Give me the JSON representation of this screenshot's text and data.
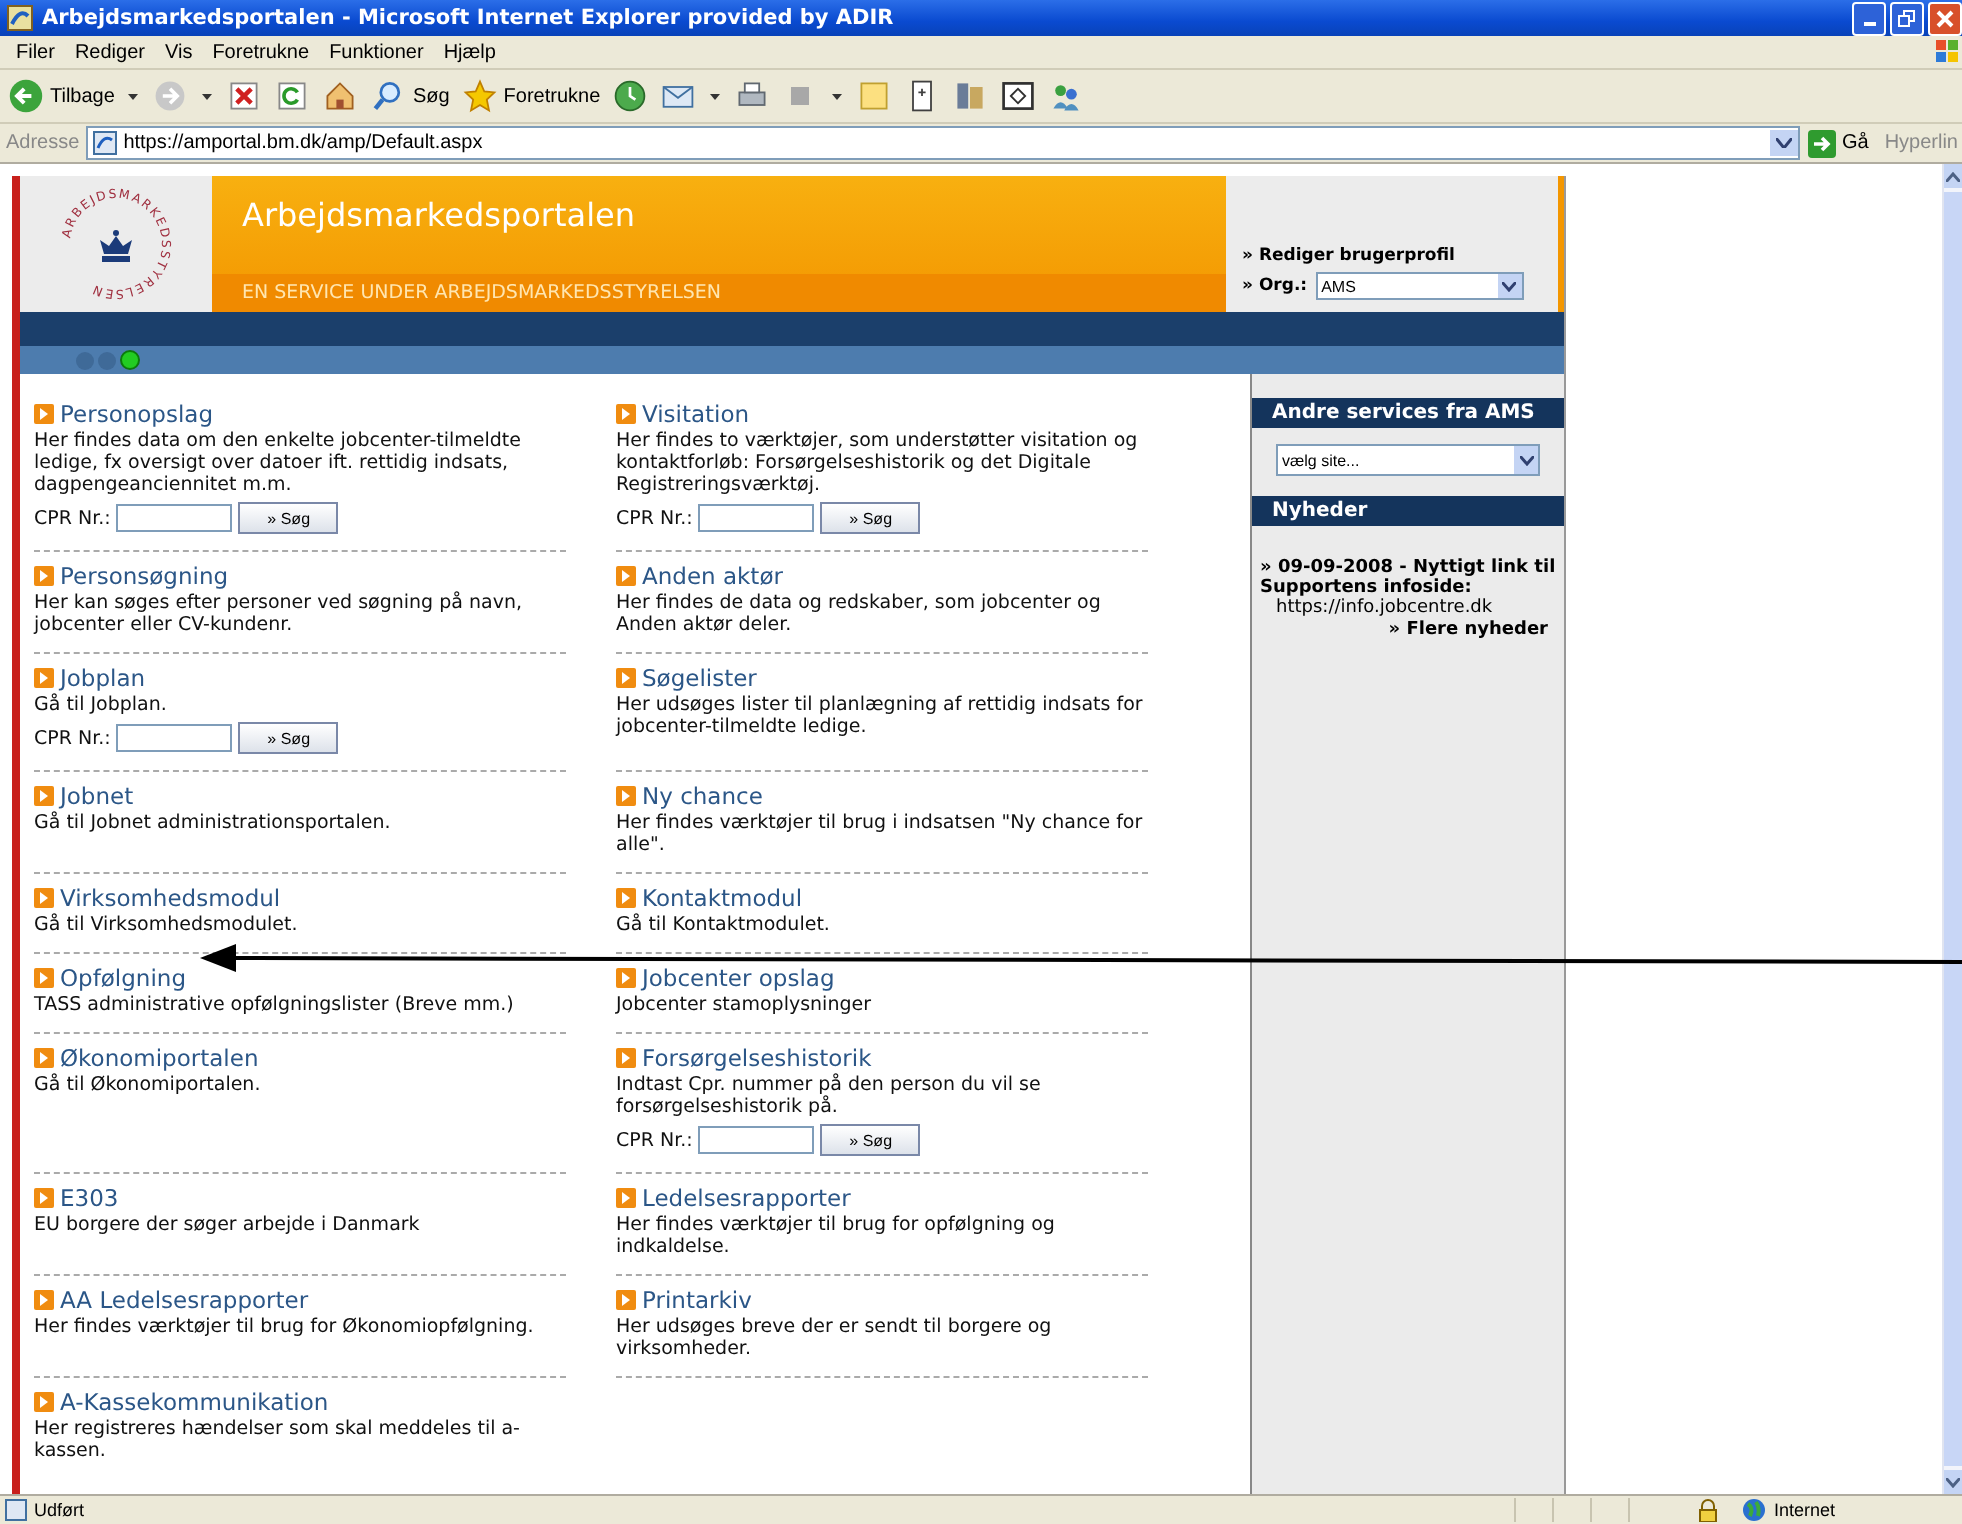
{
  "window": {
    "title": "Arbejdsmarkedsportalen - Microsoft Internet Explorer provided by ADIR"
  },
  "menu": [
    "Filer",
    "Rediger",
    "Vis",
    "Foretrukne",
    "Funktioner",
    "Hjælp"
  ],
  "toolbar": [
    {
      "kind": "back",
      "label": "Tilbage",
      "menu": true
    },
    {
      "kind": "forward",
      "menu": true
    },
    {
      "kind": "stop"
    },
    {
      "kind": "refresh"
    },
    {
      "kind": "home"
    },
    {
      "kind": "search",
      "label": "Søg"
    },
    {
      "kind": "favorites",
      "label": "Foretrukne"
    },
    {
      "kind": "history"
    },
    {
      "kind": "mail",
      "menu": true
    },
    {
      "kind": "print"
    },
    {
      "kind": "block",
      "menu": true
    },
    {
      "kind": "note"
    },
    {
      "kind": "page"
    },
    {
      "kind": "research"
    },
    {
      "kind": "window"
    },
    {
      "kind": "messenger"
    }
  ],
  "address": {
    "label": "Adresse",
    "url": "https://amportal.bm.dk/amp/Default.aspx",
    "go": "Gå",
    "links": "Hyperlin"
  },
  "portal": {
    "logo_text": "ARBEJDSMARKEDSSTYRELSEN",
    "title": "Arbejdsmarkedsportalen",
    "subtitle": "EN SERVICE UNDER ARBEJDSMARKEDSSTYRELSEN",
    "profile_link": "» Rediger brugerprofil",
    "org_label": "» Org.:",
    "org_value": "AMS",
    "lights": [
      {
        "on": false
      },
      {
        "on": false
      },
      {
        "on": true
      }
    ]
  },
  "rows": [
    {
      "left": {
        "title": "Personopslag",
        "text": "Her findes data om den enkelte jobcenter-tilmeldte ledige, fx oversigt over datoer ift. rettidig indsats, dagpengeanciennitet m.m.",
        "cpr": {
          "label": "CPR Nr.:",
          "button": "» Søg"
        }
      },
      "right": {
        "title": "Visitation",
        "text": "Her findes to værktøjer, som understøtter visitation og kontaktforløb: Forsørgelseshistorik og det Digitale Registreringsværktøj.",
        "cpr": {
          "label": "CPR Nr.:",
          "button": "» Søg"
        }
      }
    },
    {
      "left": {
        "title": "Personsøgning",
        "text": "Her kan søges efter personer ved søgning på navn, jobcenter eller CV-kundenr."
      },
      "right": {
        "title": "Anden aktør",
        "text": "Her findes de data og redskaber, som jobcenter og Anden aktør deler."
      }
    },
    {
      "left": {
        "title": "Jobplan",
        "text": "Gå til Jobplan.",
        "cpr": {
          "label": "CPR Nr.:",
          "button": "» Søg"
        }
      },
      "right": {
        "title": "Søgelister",
        "text": "Her udsøges lister til planlægning af rettidig indsats for jobcenter-tilmeldte ledige."
      }
    },
    {
      "left": {
        "title": "Jobnet",
        "text": "Gå til Jobnet administrationsportalen."
      },
      "right": {
        "title": "Ny chance",
        "text": "Her findes værktøjer til brug i indsatsen \"Ny chance for alle\"."
      }
    },
    {
      "left": {
        "title": "Virksomhedsmodul",
        "text": "Gå til Virksomhedsmodulet."
      },
      "right": {
        "title": "Kontaktmodul",
        "text": "Gå til Kontaktmodulet."
      }
    },
    {
      "left": {
        "title": "Opfølgning",
        "text": "TASS administrative opfølgningslister (Breve mm.)"
      },
      "right": {
        "title": "Jobcenter opslag",
        "text": "Jobcenter stamoplysninger"
      }
    },
    {
      "left": {
        "title": "Økonomiportalen",
        "text": "Gå til Økonomiportalen."
      },
      "right": {
        "title": "Forsørgelseshistorik",
        "text": "Indtast Cpr. nummer på den person du vil se forsørgelseshistorik på.",
        "cpr": {
          "label": "CPR Nr.:",
          "button": "» Søg"
        }
      }
    },
    {
      "left": {
        "title": "E303",
        "text": "EU borgere der søger arbejde i Danmark"
      },
      "right": {
        "title": "Ledelsesrapporter",
        "text": "Her findes værktøjer til brug for opfølgning og indkaldelse."
      }
    },
    {
      "left": {
        "title": "AA Ledelsesrapporter",
        "text": "Her findes værktøjer til brug for Økonomiopfølgning."
      },
      "right": {
        "title": "Printarkiv",
        "text": "Her udsøges breve der er sendt til borgere og virksomheder."
      }
    },
    {
      "left": {
        "title": "A-Kassekommunikation",
        "text": "Her registreres hændelser som skal meddeles til a-kassen."
      }
    }
  ],
  "sidebar": {
    "services_heading": "Andre services fra AMS",
    "services_select": "vælg site...",
    "news_heading": "Nyheder",
    "news": "» 09-09-2008 - Nyttigt link til Supportens infoside:",
    "news_link": "https://info.jobcentre.dk",
    "more_news": "» Flere nyheder"
  },
  "status_bar": {
    "text": "Udført",
    "zone": "Internet"
  }
}
